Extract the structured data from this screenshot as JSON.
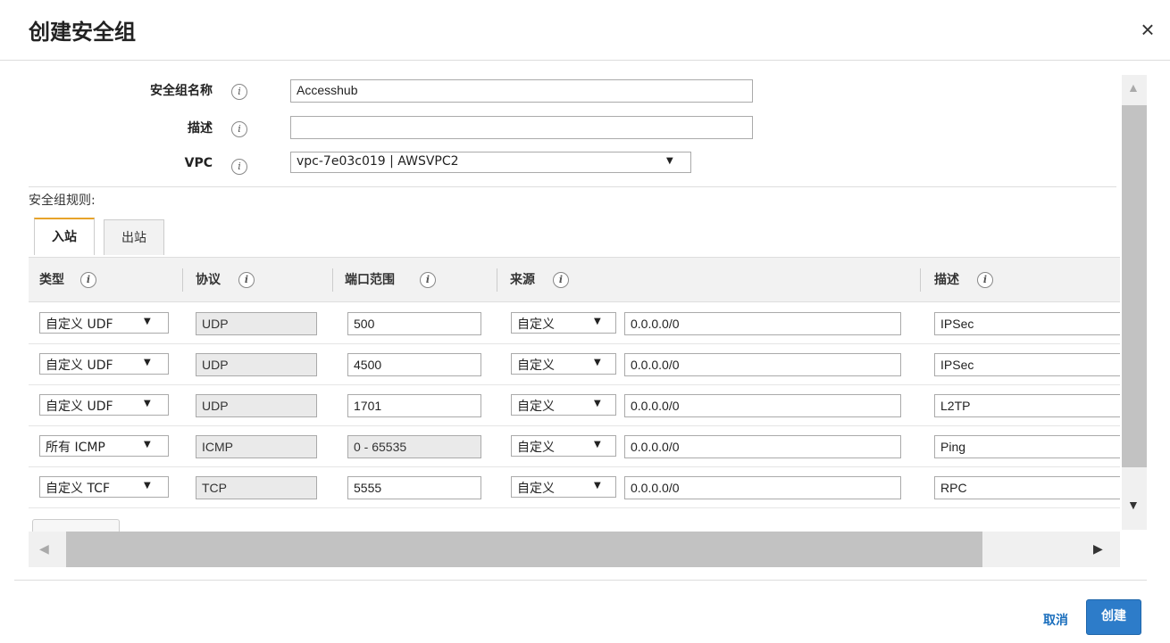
{
  "modal": {
    "title": "创建安全组",
    "close_glyph": "×"
  },
  "form": {
    "name_label": "安全组名称",
    "name_value": "Accesshub",
    "description_label": "描述",
    "description_value": "",
    "vpc_label": "VPC",
    "vpc_value": "vpc-7e03c019 | AWSVPC2",
    "info_glyph": "i"
  },
  "rules": {
    "section_label": "安全组规则:",
    "tabs": [
      {
        "label": "入站",
        "active": true
      },
      {
        "label": "出站",
        "active": false
      }
    ],
    "columns": {
      "type": "类型",
      "protocol": "协议",
      "port_range": "端口范围",
      "source": "来源",
      "description": "描述"
    },
    "rows": [
      {
        "type": "自定义 UDF",
        "protocol": "UDP",
        "port": "500",
        "source_type": "自定义",
        "source_cidr": "0.0.0.0/0",
        "description": "IPSec"
      },
      {
        "type": "自定义 UDF",
        "protocol": "UDP",
        "port": "4500",
        "source_type": "自定义",
        "source_cidr": "0.0.0.0/0",
        "description": "IPSec"
      },
      {
        "type": "自定义 UDF",
        "protocol": "UDP",
        "port": "1701",
        "source_type": "自定义",
        "source_cidr": "0.0.0.0/0",
        "description": "L2TP"
      },
      {
        "type": "所有 ICMP",
        "protocol": "ICMP",
        "port": "0 - 65535",
        "source_type": "自定义",
        "source_cidr": "0.0.0.0/0",
        "description": "Ping"
      },
      {
        "type": "自定义 TCF",
        "protocol": "TCP",
        "port": "5555",
        "source_type": "自定义",
        "source_cidr": "0.0.0.0/0",
        "description": "RPC"
      }
    ]
  },
  "footer": {
    "cancel_label": "取消",
    "create_label": "创建"
  },
  "icons": {
    "dropdown": "chevron-down-icon",
    "scroll_up": "triangle-up-icon",
    "scroll_down": "triangle-down-icon",
    "scroll_left": "triangle-left-icon",
    "scroll_right": "triangle-right-icon"
  },
  "colors": {
    "tab_accent": "#e7a32a",
    "primary_button": "#2d7cc9",
    "link": "#1a6ebd"
  }
}
